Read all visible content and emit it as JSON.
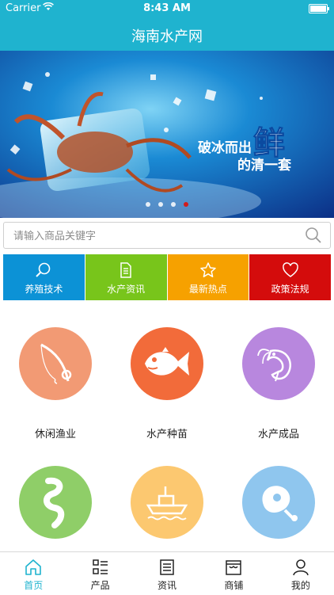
{
  "status_bar": {
    "carrier": "Carrier",
    "time": "8:43 AM"
  },
  "nav": {
    "title": "海南水产网"
  },
  "banner": {
    "text_main": "破冰而出",
    "text_big": "鲜",
    "text_sub": "的清一套",
    "slides": 4,
    "active_slide": 4
  },
  "search": {
    "placeholder": "请输入商品关键字"
  },
  "categories": [
    {
      "label": "养殖技术",
      "color": "#0c92d6",
      "icon": "magnifier-icon"
    },
    {
      "label": "水产资讯",
      "color": "#78c51b",
      "icon": "document-icon"
    },
    {
      "label": "最新热点",
      "color": "#f6a100",
      "icon": "star-icon"
    },
    {
      "label": "政策法规",
      "color": "#d40c0c",
      "icon": "heart-icon"
    }
  ],
  "grid": [
    {
      "label": "休闲渔业",
      "color": "#f29a74",
      "icon": "fishing-rod-icon"
    },
    {
      "label": "水产种苗",
      "color": "#f26b3a",
      "icon": "fish-icon"
    },
    {
      "label": "水产成品",
      "color": "#b887de",
      "icon": "shrimp-icon"
    },
    {
      "label": "",
      "color": "#8fce68",
      "icon": "worm-icon"
    },
    {
      "label": "",
      "color": "#fcc870",
      "icon": "boat-icon"
    },
    {
      "label": "",
      "color": "#8fc6ee",
      "icon": "meat-icon"
    }
  ],
  "tabs": [
    {
      "label": "首页",
      "icon": "home-icon",
      "active": true
    },
    {
      "label": "产品",
      "icon": "list-icon",
      "active": false
    },
    {
      "label": "资讯",
      "icon": "news-icon",
      "active": false
    },
    {
      "label": "商铺",
      "icon": "shop-icon",
      "active": false
    },
    {
      "label": "我的",
      "icon": "user-icon",
      "active": false
    }
  ],
  "colors": {
    "brand": "#1fb3cf",
    "indicator_active": "#d21c1c"
  }
}
